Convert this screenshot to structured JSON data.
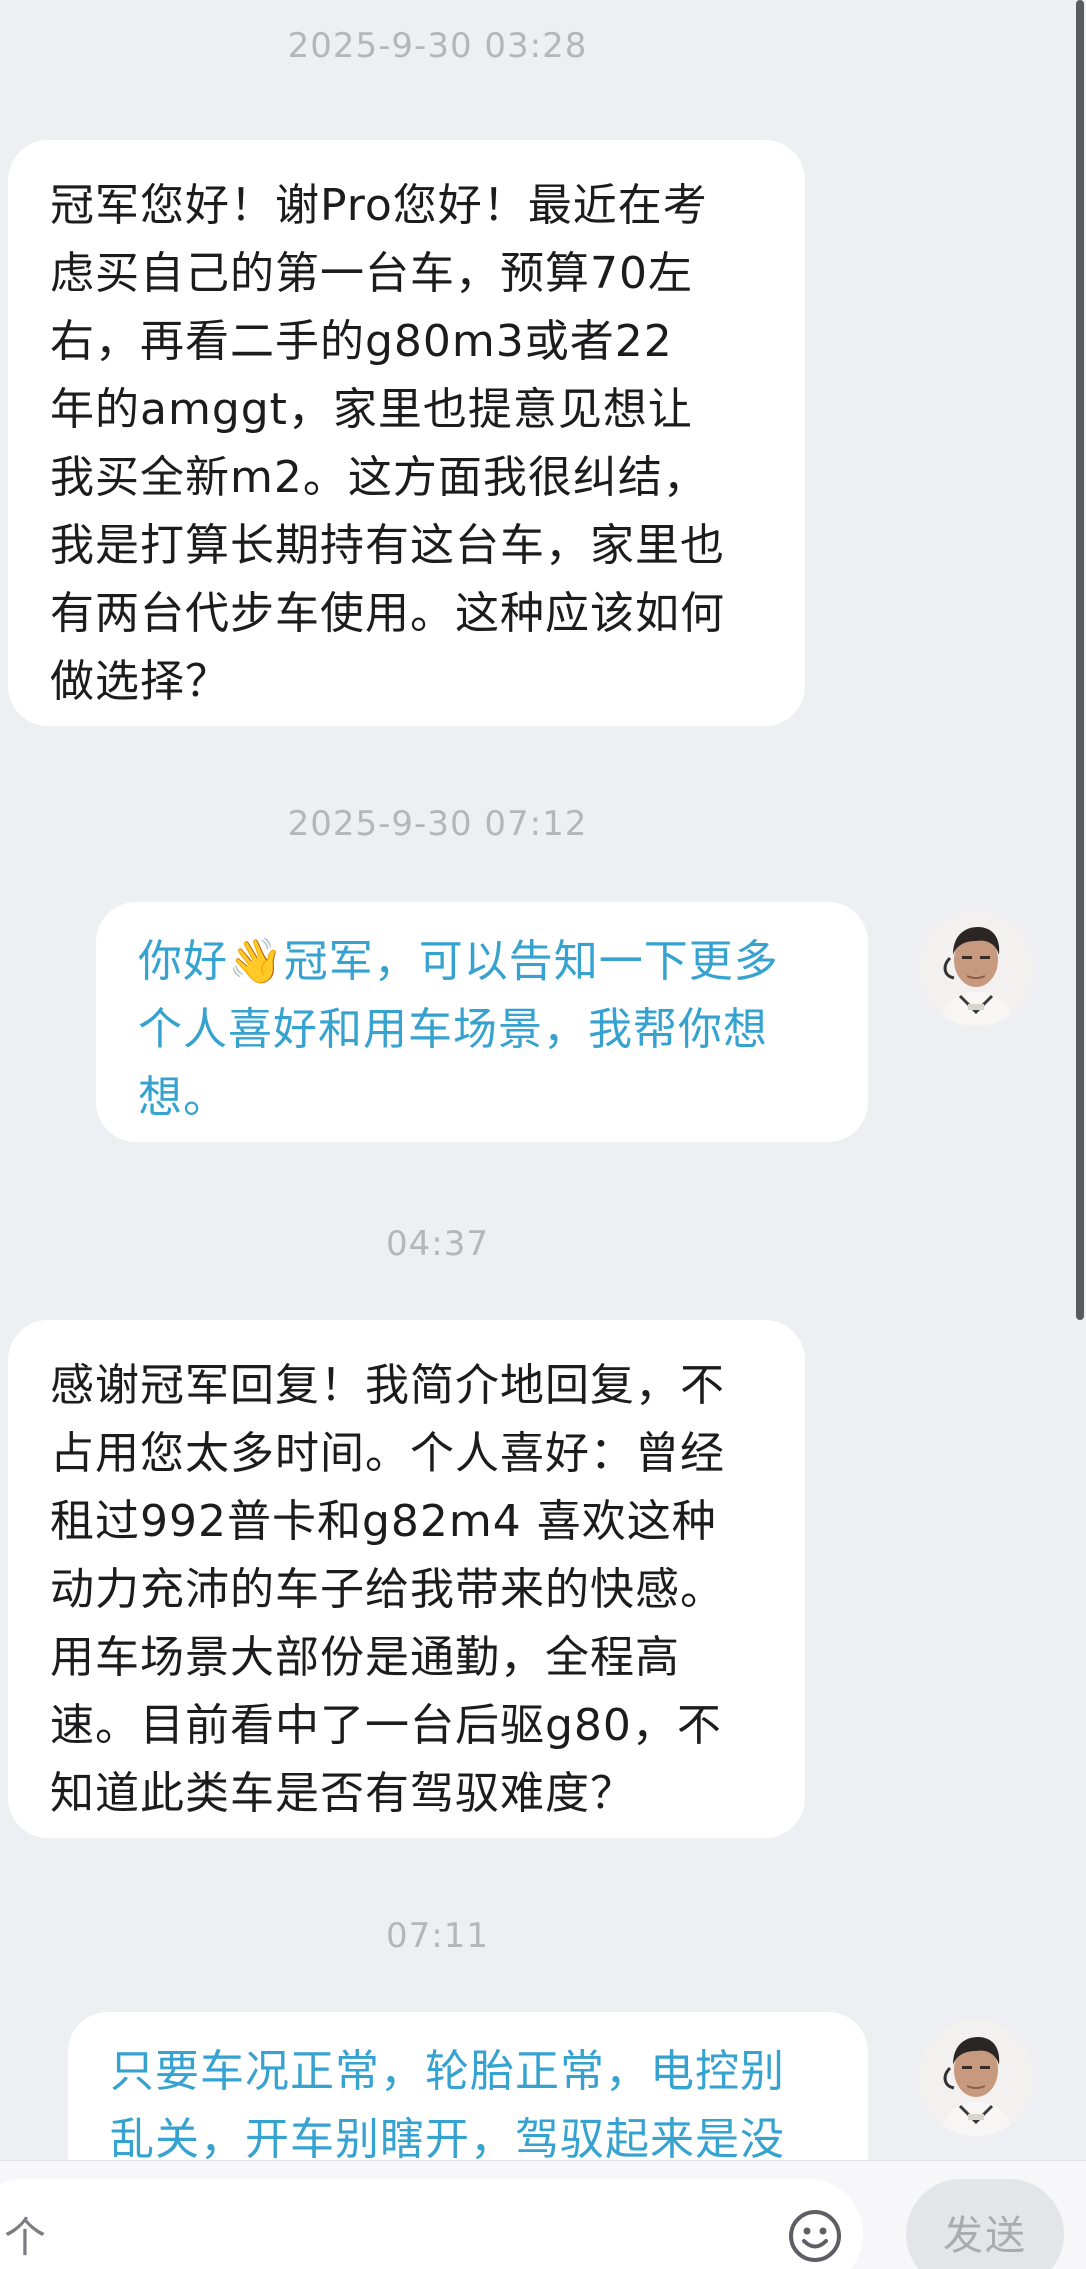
{
  "messages": [
    {
      "timestamp": "2025-9-30 03:28",
      "direction": "received",
      "lines": [
        "冠军您好！谢Pro您好！最近在考",
        "虑买自己的第一台车，预算70左",
        "右，再看二手的g80m3或者22",
        "年的amggt，家里也提意见想让",
        "我买全新m2。这方面我很纠结，",
        "我是打算长期持有这台车，家里也",
        "有两台代步车使用。这种应该如何",
        "做选择？"
      ]
    },
    {
      "timestamp": "2025-9-30 07:12",
      "direction": "sent",
      "lines": [
        "你好👋冠军，可以告知一下更多",
        "个人喜好和用车场景，我帮你想",
        "想。"
      ]
    },
    {
      "timestamp": "04:37",
      "direction": "received",
      "lines": [
        "感谢冠军回复！我简介地回复，不",
        "占用您太多时间。个人喜好：曾经",
        "租过992普卡和g82m4 喜欢这种",
        "动力充沛的车子给我带来的快感。",
        "用车场景大部份是通勤，全程高",
        "速。目前看中了一台后驱g80，不",
        "知道此类车是否有驾驭难度？"
      ]
    },
    {
      "timestamp": "07:11",
      "direction": "sent",
      "lines": [
        "只要车况正常，轮胎正常，电控别",
        "乱关，开车别瞎开，驾驭起来是没"
      ]
    }
  ],
  "input": {
    "value": "个"
  },
  "send_button": {
    "label": "发送"
  },
  "icons": {
    "emoji": "emoji-face-icon",
    "avatar": "profile-photo"
  },
  "colors": {
    "sent_text": "#36a2d0",
    "received_text": "#1c1c1e",
    "background": "#eeeff3",
    "timestamp": "#b4b6bb"
  }
}
